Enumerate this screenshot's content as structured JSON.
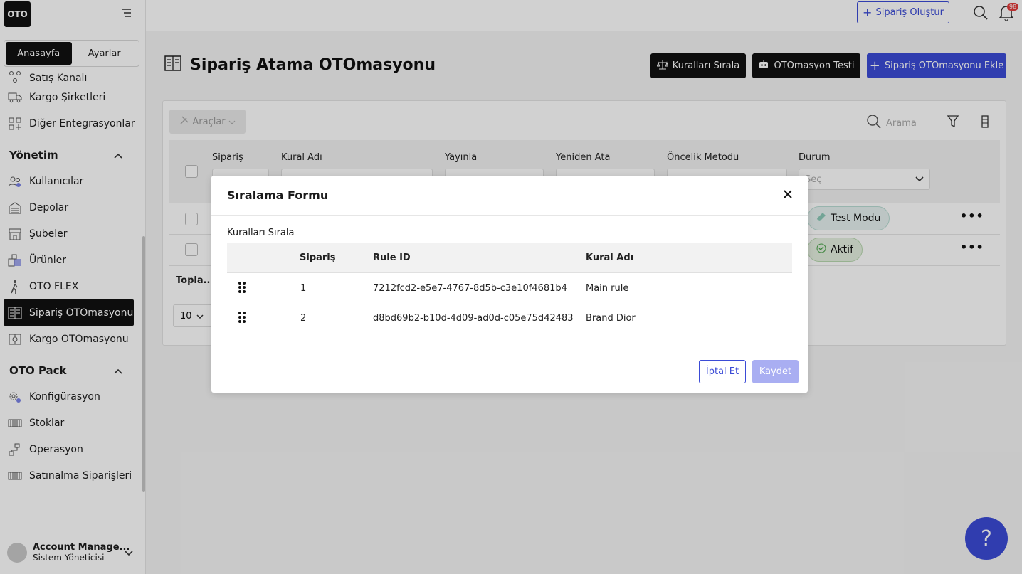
{
  "brand": {
    "logo_text": "OTO"
  },
  "sidebar": {
    "tabs": [
      {
        "label": "Anasayfa"
      },
      {
        "label": "Ayarlar"
      }
    ],
    "items_top": [
      {
        "label": "Satış Kanalı",
        "icon": "sales-channel-icon"
      },
      {
        "label": "Kargo Şirketleri",
        "icon": "truck-icon"
      },
      {
        "label": "Diğer Entegrasyonlar",
        "icon": "grid-plus-icon"
      }
    ],
    "section_management": "Yönetim",
    "items_management": [
      {
        "label": "Kullanıcılar",
        "icon": "users-icon"
      },
      {
        "label": "Depolar",
        "icon": "warehouse-icon"
      },
      {
        "label": "Şubeler",
        "icon": "store-icon"
      },
      {
        "label": "Ürünler",
        "icon": "products-icon"
      },
      {
        "label": "OTO FLEX",
        "icon": "person-walking-icon"
      },
      {
        "label": "Sipariş OTOmasyonu",
        "icon": "order-automation-icon"
      },
      {
        "label": "Kargo OTOmasyonu",
        "icon": "cargo-automation-icon"
      }
    ],
    "section_pack": "OTO Pack",
    "items_pack": [
      {
        "label": "Konfigürasyon",
        "icon": "config-icon"
      },
      {
        "label": "Stoklar",
        "icon": "stock-icon"
      },
      {
        "label": "Operasyon",
        "icon": "operation-icon"
      },
      {
        "label": "Satınalma Siparişleri",
        "icon": "purchase-icon"
      }
    ],
    "account": {
      "name": "Account Manage...",
      "role": "Sistem Yöneticisi"
    }
  },
  "topbar": {
    "create_label": "Sipariş Oluştur",
    "notification_count": "98"
  },
  "page": {
    "title": "Sipariş Atama OTOmasyonu",
    "buttons": {
      "sort_rules": "Kuralları Sırala",
      "test": "OTOmasyon Testi",
      "add": "Sipariş OTOmasyonu Ekle"
    },
    "tools_label": "Araçlar",
    "search_placeholder": "Arama",
    "columns": [
      "Sipariş",
      "Kural Adı",
      "Yayınla",
      "Yeniden Ata",
      "Öncelik Metodu",
      "Durum"
    ],
    "status_placeholder": "Seç",
    "rows": [
      {
        "status": "Test Modu"
      },
      {
        "status": "Aktif"
      }
    ],
    "total_label": "Topla...",
    "page_size": "10"
  },
  "modal": {
    "title": "Sıralama Formu",
    "section_label": "Kuralları Sırala",
    "headers": {
      "order": "Sipariş",
      "rule_id": "Rule ID",
      "rule_name": "Kural Adı"
    },
    "rows": [
      {
        "order": "1",
        "rule_id": "7212fcd2-e5e7-4767-8d5b-c3e10f4681b4",
        "rule_name": "Main rule"
      },
      {
        "order": "2",
        "rule_id": "d8bd69b2-b10d-4d09-ad0d-c05e75d42483",
        "rule_name": "Brand Dior"
      }
    ],
    "cancel_label": "İptal Et",
    "save_label": "Kaydet"
  },
  "help_label": "?",
  "colors": {
    "accent": "#3b4bd6",
    "dark": "#111111",
    "test_mode_bg": "#e6f1ef",
    "active_bg": "#e4f0e0"
  }
}
